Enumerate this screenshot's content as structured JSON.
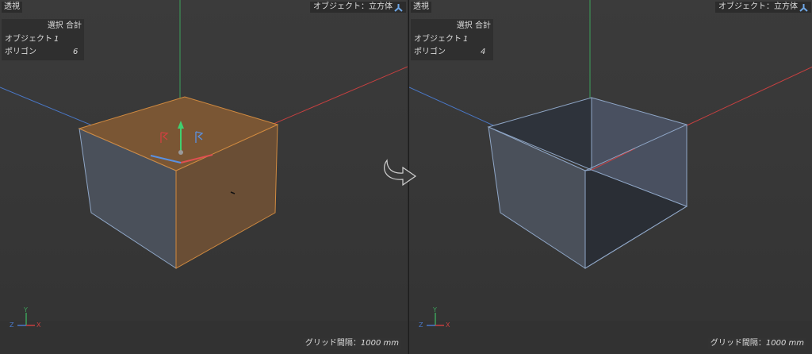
{
  "viewports": {
    "left": {
      "title": "透視",
      "object_label": "オブジェクト：立方体",
      "stats": {
        "header": "選択 合計",
        "rows": [
          {
            "label": "オブジェクト",
            "value": "1"
          },
          {
            "label": "ポリゴン",
            "value": "6"
          }
        ]
      },
      "grid_label": "グリッド間隔：",
      "grid_value": "1000 mm",
      "gizmo": {
        "y": "Y",
        "x": "X",
        "z": "Z"
      }
    },
    "right": {
      "title": "透視",
      "object_label": "オブジェクト：立方体",
      "stats": {
        "header": "選択 合計",
        "rows": [
          {
            "label": "オブジェクト",
            "value": "1"
          },
          {
            "label": "ポリゴン",
            "value": "4"
          }
        ]
      },
      "grid_label": "グリッド間隔：",
      "grid_value": "1000 mm",
      "gizmo": {
        "y": "Y",
        "x": "X",
        "z": "Z"
      }
    }
  },
  "colors": {
    "selection": "#b87a3a",
    "cube_face": "#4a505a",
    "cube_edge": "#8fa6c6",
    "inner_face": "#2e333b",
    "axis_x": "#c84040",
    "axis_y": "#3ca05a",
    "axis_z": "#4a78c8"
  },
  "icons": {
    "object": "cube-object-icon",
    "transition": "curved-arrow-icon",
    "axis_gizmo": "axis-gizmo-icon"
  }
}
